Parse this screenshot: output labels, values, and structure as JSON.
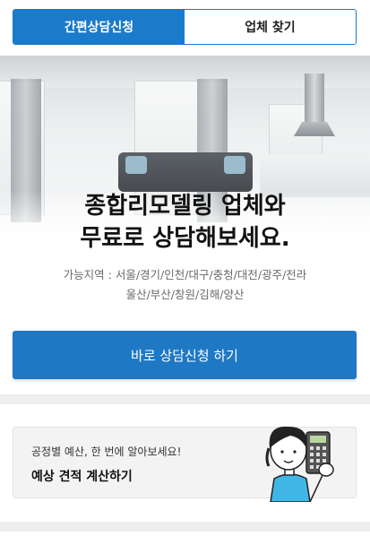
{
  "tabs": [
    {
      "label": "간편상담신청",
      "active": true
    },
    {
      "label": "업체 찾기",
      "active": false
    }
  ],
  "hero": {
    "headline_line1": "종합리모델링 업체와",
    "headline_line2": "무료로 상담해보세요.",
    "region_line1": "가능지역 : 서울/경기/인천/대구/충청/대전/광주/전라",
    "region_line2": "울산/부산/창원/김해/양산"
  },
  "cta": {
    "label": "바로 상담신청 하기"
  },
  "calculator": {
    "subtitle": "공정별 예산, 한 번에 알아보세요!",
    "title": "예상 견적 계산하기",
    "illustration_icon": "person-with-calculator-icon"
  },
  "colors": {
    "accent": "#1b7ac9",
    "divider": "#eeeeee",
    "card_bg": "#f3f3f3"
  }
}
